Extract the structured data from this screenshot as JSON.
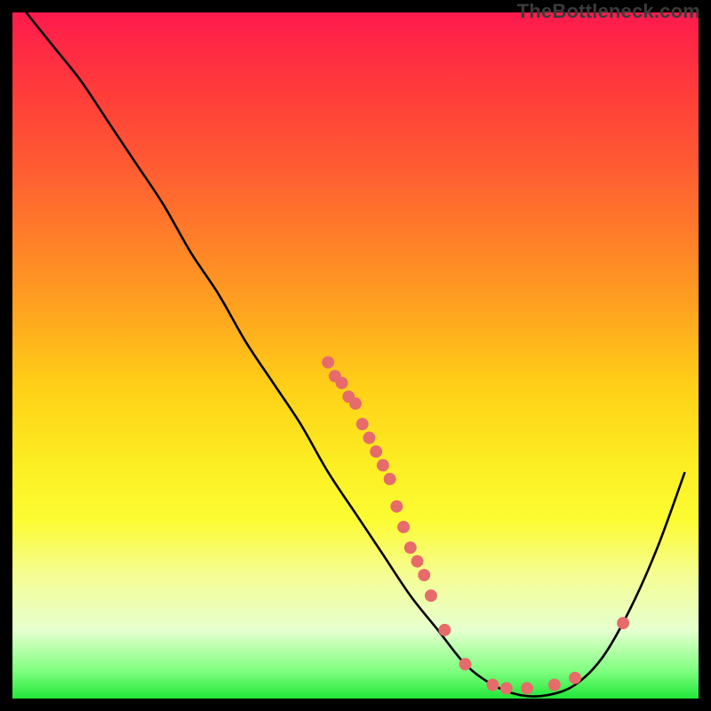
{
  "watermark": "TheBottleneck.com",
  "chart_data": {
    "type": "line",
    "title": "",
    "xlabel": "",
    "ylabel": "",
    "xlim": [
      0,
      100
    ],
    "ylim": [
      0,
      100
    ],
    "curve": [
      {
        "x": 2,
        "y": 100
      },
      {
        "x": 6,
        "y": 95
      },
      {
        "x": 10,
        "y": 90
      },
      {
        "x": 14,
        "y": 84
      },
      {
        "x": 18,
        "y": 78
      },
      {
        "x": 22,
        "y": 72
      },
      {
        "x": 26,
        "y": 65
      },
      {
        "x": 30,
        "y": 59
      },
      {
        "x": 34,
        "y": 52
      },
      {
        "x": 38,
        "y": 46
      },
      {
        "x": 42,
        "y": 40
      },
      {
        "x": 46,
        "y": 33
      },
      {
        "x": 50,
        "y": 27
      },
      {
        "x": 54,
        "y": 21
      },
      {
        "x": 58,
        "y": 15
      },
      {
        "x": 62,
        "y": 10
      },
      {
        "x": 66,
        "y": 5
      },
      {
        "x": 70,
        "y": 2
      },
      {
        "x": 74,
        "y": 0.5
      },
      {
        "x": 78,
        "y": 0.5
      },
      {
        "x": 82,
        "y": 2
      },
      {
        "x": 86,
        "y": 6
      },
      {
        "x": 90,
        "y": 13
      },
      {
        "x": 94,
        "y": 22
      },
      {
        "x": 98,
        "y": 33
      }
    ],
    "markers": [
      {
        "x": 46,
        "y": 49
      },
      {
        "x": 47,
        "y": 47
      },
      {
        "x": 48,
        "y": 46
      },
      {
        "x": 49,
        "y": 44
      },
      {
        "x": 50,
        "y": 43
      },
      {
        "x": 51,
        "y": 40
      },
      {
        "x": 52,
        "y": 38
      },
      {
        "x": 53,
        "y": 36
      },
      {
        "x": 54,
        "y": 34
      },
      {
        "x": 55,
        "y": 32
      },
      {
        "x": 56,
        "y": 28
      },
      {
        "x": 57,
        "y": 25
      },
      {
        "x": 58,
        "y": 22
      },
      {
        "x": 59,
        "y": 20
      },
      {
        "x": 60,
        "y": 18
      },
      {
        "x": 61,
        "y": 15
      },
      {
        "x": 63,
        "y": 10
      },
      {
        "x": 66,
        "y": 5
      },
      {
        "x": 70,
        "y": 2
      },
      {
        "x": 72,
        "y": 1.5
      },
      {
        "x": 75,
        "y": 1.5
      },
      {
        "x": 79,
        "y": 2
      },
      {
        "x": 82,
        "y": 3
      },
      {
        "x": 89,
        "y": 11
      }
    ],
    "marker_color": "#e76b6b",
    "curve_color": "#000000"
  },
  "plot": {
    "inner_left": 12,
    "inner_top": 12,
    "inner_width": 776,
    "inner_height": 776
  }
}
